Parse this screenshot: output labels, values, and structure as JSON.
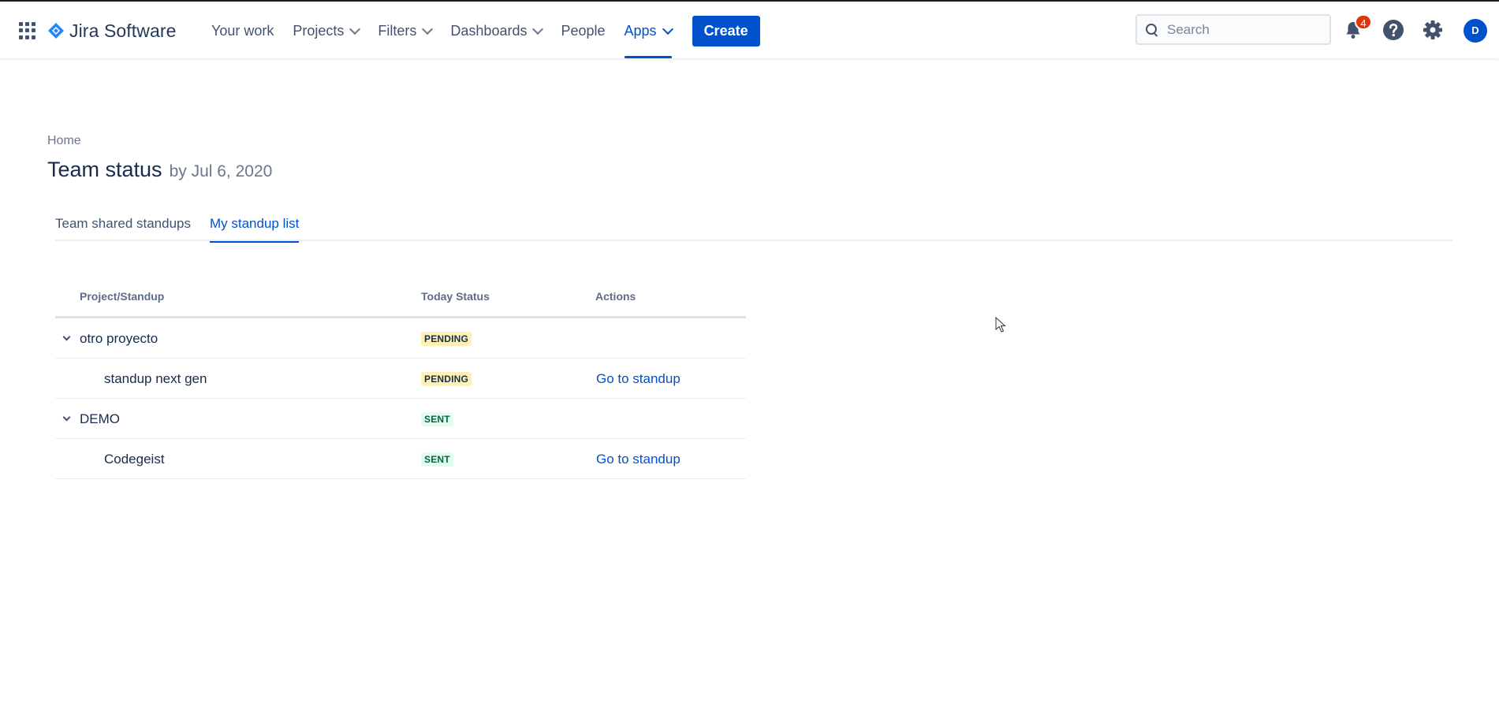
{
  "app": {
    "name": "Jira Software"
  },
  "colors": {
    "brand": "#0052cc",
    "pending_bg": "#fff0b3",
    "sent_bg": "#e3fcef",
    "notification": "#de350b"
  },
  "nav": {
    "items": [
      {
        "label": "Your work",
        "dropdown": false,
        "active": false
      },
      {
        "label": "Projects",
        "dropdown": true,
        "active": false
      },
      {
        "label": "Filters",
        "dropdown": true,
        "active": false
      },
      {
        "label": "Dashboards",
        "dropdown": true,
        "active": false
      },
      {
        "label": "People",
        "dropdown": false,
        "active": false
      },
      {
        "label": "Apps",
        "dropdown": true,
        "active": true
      }
    ],
    "create_label": "Create",
    "search_placeholder": "Search",
    "notification_count": "4",
    "avatar_initial": "D"
  },
  "page": {
    "breadcrumb": "Home",
    "title": "Team status",
    "subtitle": "by Jul 6, 2020"
  },
  "tabs": [
    {
      "label": "Team shared standups",
      "active": false
    },
    {
      "label": "My standup list",
      "active": true
    }
  ],
  "table": {
    "headers": [
      "Project/Standup",
      "Today Status",
      "Actions"
    ],
    "rows": [
      {
        "name": "otro proyecto",
        "type": "project",
        "status": "PENDING",
        "action": ""
      },
      {
        "name": "standup next gen",
        "type": "standup",
        "status": "PENDING",
        "action": "Go to standup"
      },
      {
        "name": "DEMO",
        "type": "project",
        "status": "SENT",
        "action": ""
      },
      {
        "name": "Codegeist",
        "type": "standup",
        "status": "SENT",
        "action": "Go to standup"
      }
    ]
  }
}
